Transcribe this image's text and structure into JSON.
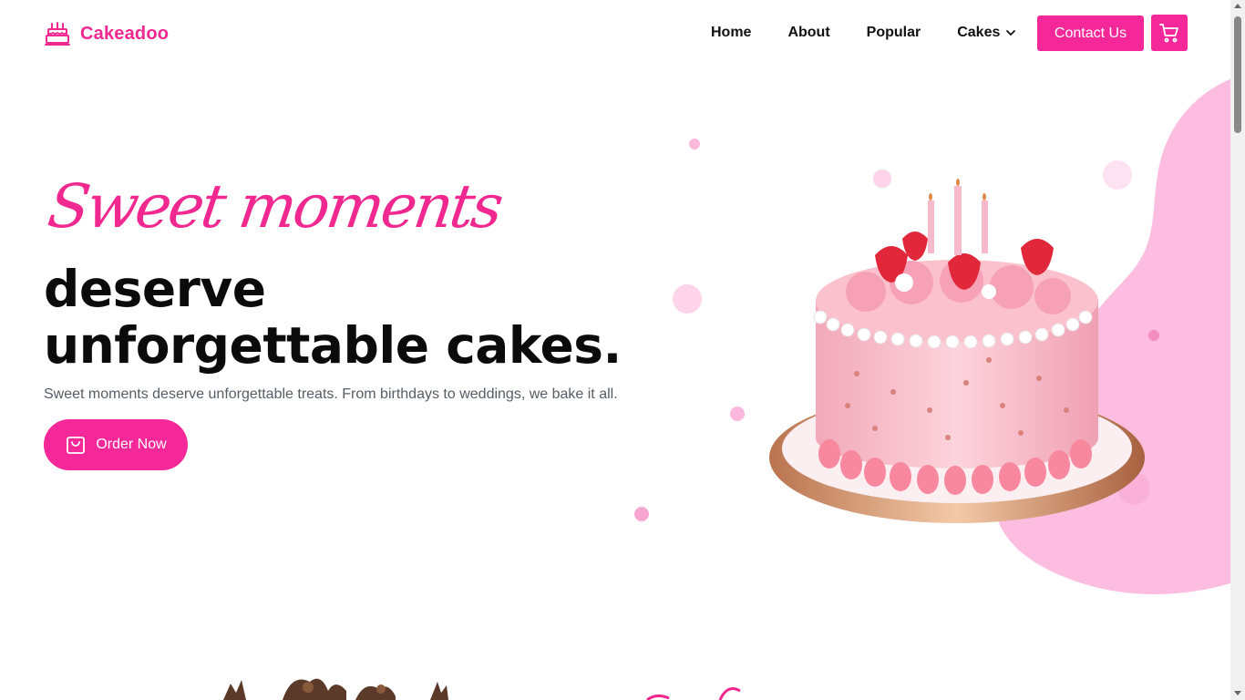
{
  "brand": {
    "name": "Cakeadoo",
    "logo_icon": "birthday-cake-icon",
    "accent_color": "#f5289a",
    "accent_light": "#fbb7dc"
  },
  "nav": {
    "items": [
      {
        "label": "Home"
      },
      {
        "label": "About"
      },
      {
        "label": "Popular"
      },
      {
        "label": "Cakes",
        "icon": "chevron-down-icon"
      }
    ],
    "contact_label": "Contact Us",
    "cart_icon": "shopping-cart-icon"
  },
  "hero": {
    "script_title": "Sweet moments",
    "title": "deserve unforgettable cakes.",
    "subtitle": "Sweet moments deserve unforgettable treats. From birthdays to weddings, we bake it all.",
    "cta_label": "Order Now",
    "cta_icon": "shopping-bag-icon",
    "image": "pink-birthday-cake-image"
  }
}
